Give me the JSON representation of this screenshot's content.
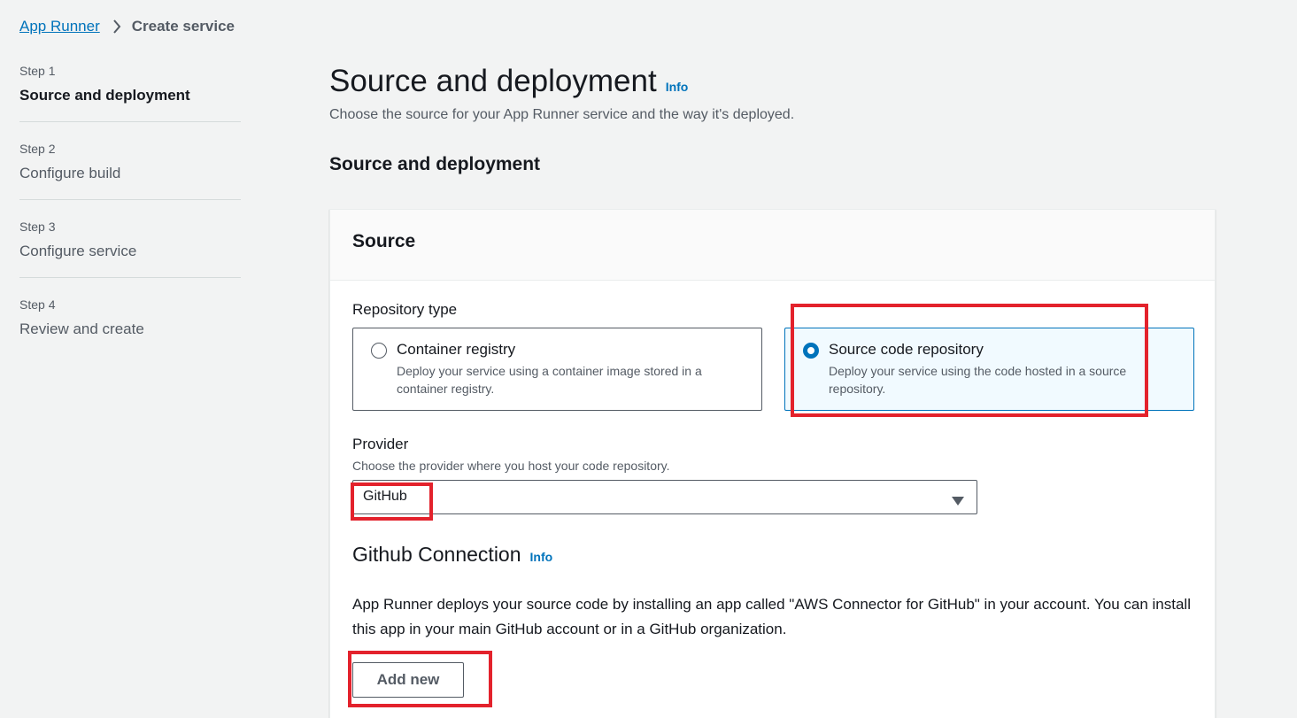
{
  "breadcrumb": {
    "link": "App Runner",
    "current": "Create service"
  },
  "steps": [
    {
      "num": "Step 1",
      "title": "Source and deployment",
      "active": true
    },
    {
      "num": "Step 2",
      "title": "Configure build",
      "active": false
    },
    {
      "num": "Step 3",
      "title": "Configure service",
      "active": false
    },
    {
      "num": "Step 4",
      "title": "Review and create",
      "active": false
    }
  ],
  "page": {
    "title": "Source and deployment",
    "info": "Info",
    "subtitle": "Choose the source for your App Runner service and the way it's deployed.",
    "section_title": "Source and deployment"
  },
  "source": {
    "title": "Source",
    "repo_type_label": "Repository type",
    "options": [
      {
        "title": "Container registry",
        "desc": "Deploy your service using a container image stored in a container registry.",
        "selected": false
      },
      {
        "title": "Source code repository",
        "desc": "Deploy your service using the code hosted in a source repository.",
        "selected": true
      }
    ],
    "provider_label": "Provider",
    "provider_desc": "Choose the provider where you host your code repository.",
    "provider_value": "GitHub",
    "connection_title": "Github Connection",
    "connection_info": "Info",
    "connection_text": "App Runner deploys your source code by installing an app called \"AWS Connector for GitHub\" in your account. You can install this app in your main GitHub account or in a GitHub organization.",
    "add_new_label": "Add new"
  },
  "colors": {
    "link": "#0073bb",
    "highlight": "#e3222c",
    "selected_bg": "#f1faff"
  }
}
